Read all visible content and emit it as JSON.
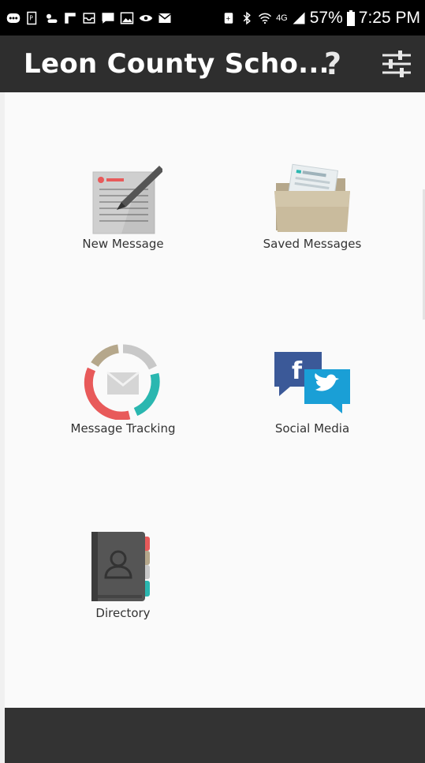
{
  "status_bar": {
    "battery": "57%",
    "time": "7:25 PM",
    "network": "4G"
  },
  "app_bar": {
    "title": "Leon County Scho...",
    "help_label": "?"
  },
  "tiles": [
    {
      "label": "New Message",
      "icon": "new-message-icon"
    },
    {
      "label": "Saved Messages",
      "icon": "folder-icon"
    },
    {
      "label": "Message Tracking",
      "icon": "tracking-icon"
    },
    {
      "label": "Social Media",
      "icon": "social-media-icon"
    },
    {
      "label": "Directory",
      "icon": "directory-book-icon"
    }
  ],
  "colors": {
    "status_bar": "#000000",
    "app_bar": "#2e2e2e",
    "content_bg": "#fafafa",
    "bottom_bar": "#333333",
    "accent_red": "#e85a5a",
    "accent_teal": "#2ab7b0",
    "facebook_blue": "#3b5998",
    "twitter_blue": "#1da1f2"
  }
}
